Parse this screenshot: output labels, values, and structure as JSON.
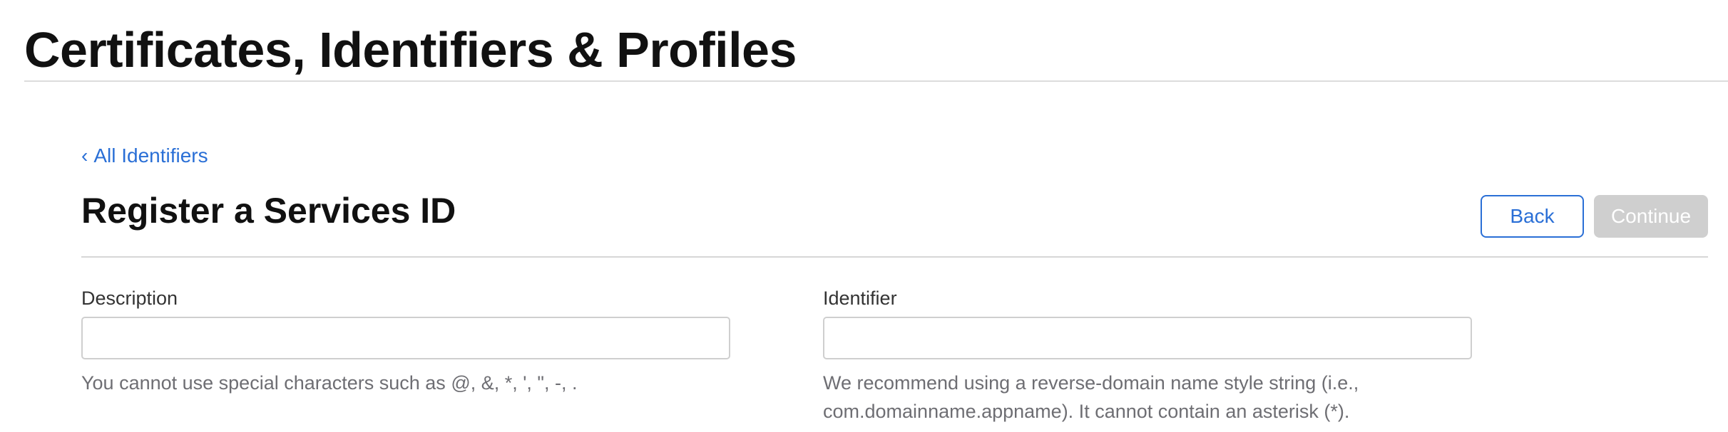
{
  "header": {
    "title": "Certificates, Identifiers & Profiles"
  },
  "nav": {
    "back_link_chevron": "‹",
    "back_link_label": "All Identifiers"
  },
  "form": {
    "title": "Register a Services ID",
    "buttons": {
      "back_label": "Back",
      "continue_label": "Continue",
      "continue_enabled": false
    },
    "fields": {
      "description": {
        "label": "Description",
        "value": "",
        "placeholder": "",
        "help": "You cannot use special characters such as @, &, *, ', \", -, ."
      },
      "identifier": {
        "label": "Identifier",
        "value": "",
        "placeholder": "",
        "help": "We recommend using a reverse-domain name style string (i.e., com.domainname.appname). It cannot contain an asterisk (*)."
      }
    }
  },
  "colors": {
    "accent": "#2a6fd6",
    "disabled_button": "#cfcfcf",
    "title_text": "#111111",
    "help_text": "#6e6e73"
  }
}
